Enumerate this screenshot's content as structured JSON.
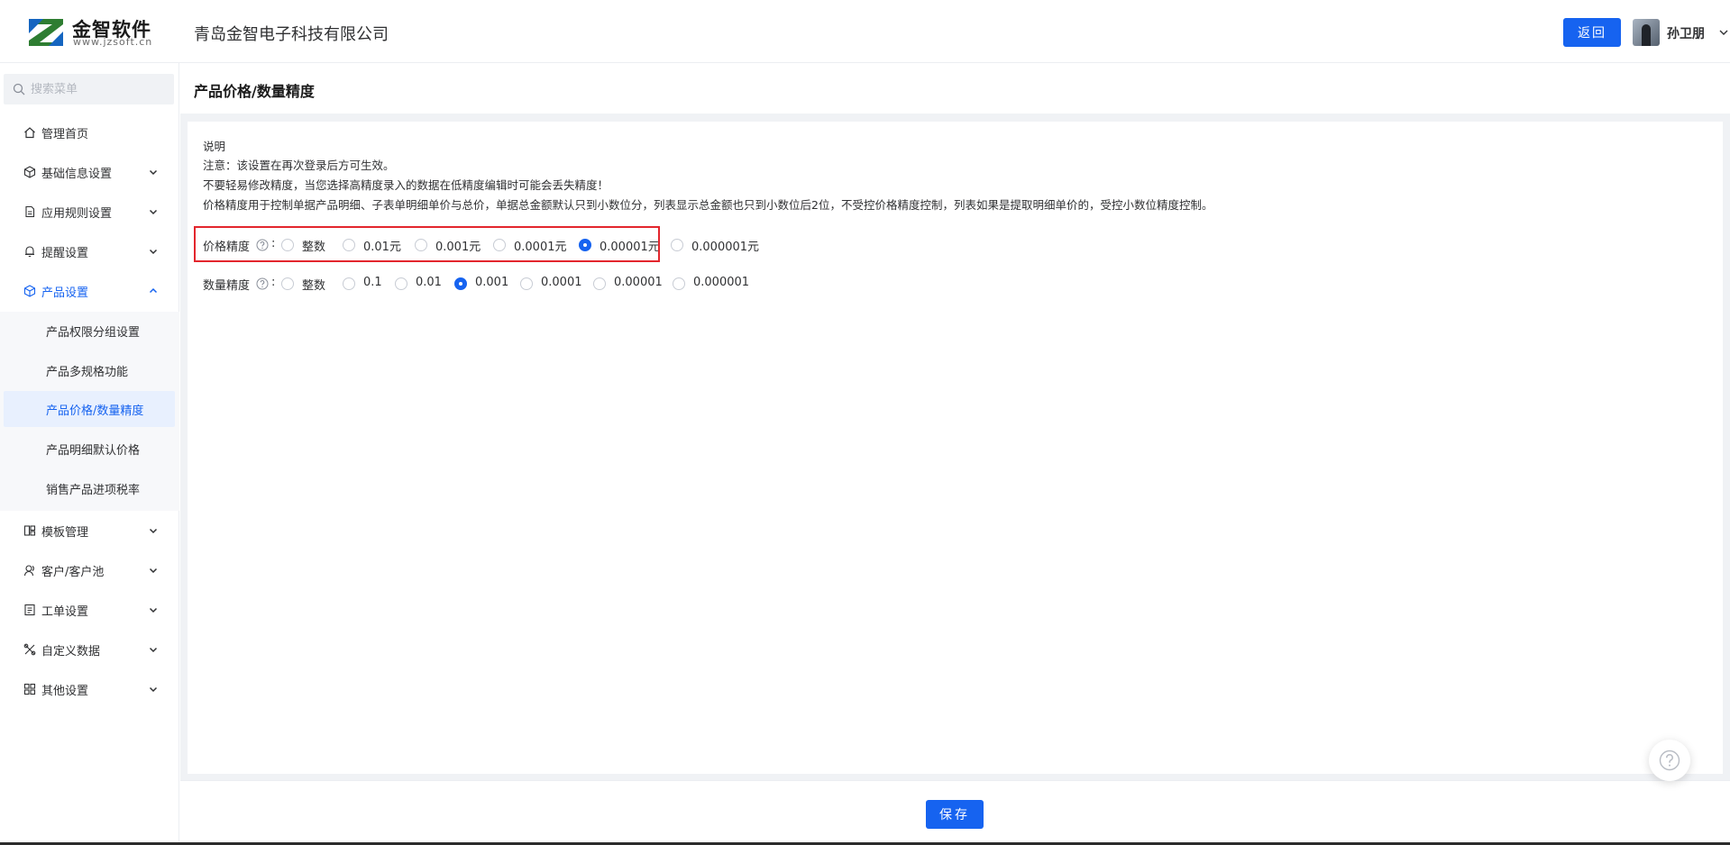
{
  "header": {
    "logo_name": "金智软件",
    "logo_url": "www.jzsoft.cn",
    "company": "青岛金智电子科技有限公司",
    "back_label": "返回",
    "user_name": "孙卫朋"
  },
  "sidebar": {
    "search_placeholder": "搜索菜单",
    "items": [
      {
        "label": "管理首页",
        "icon": "home-icon"
      },
      {
        "label": "基础信息设置",
        "icon": "cube-icon"
      },
      {
        "label": "应用规则设置",
        "icon": "document-icon"
      },
      {
        "label": "提醒设置",
        "icon": "bell-icon"
      },
      {
        "label": "产品设置",
        "icon": "product-icon"
      },
      {
        "label": "模板管理",
        "icon": "template-icon"
      },
      {
        "label": "客户/客户池",
        "icon": "customer-icon"
      },
      {
        "label": "工单设置",
        "icon": "ticket-icon"
      },
      {
        "label": "自定义数据",
        "icon": "tools-icon"
      },
      {
        "label": "其他设置",
        "icon": "grid-icon"
      }
    ],
    "product_sub": [
      {
        "label": "产品权限分组设置"
      },
      {
        "label": "产品多规格功能"
      },
      {
        "label": "产品价格/数量精度"
      },
      {
        "label": "产品明细默认价格"
      },
      {
        "label": "销售产品进项税率"
      }
    ]
  },
  "main": {
    "page_title": "产品价格/数量精度",
    "desc": [
      "说明",
      "注意：该设置在再次登录后方可生效。",
      "不要轻易修改精度，当您选择高精度录入的数据在低精度编辑时可能会丢失精度！",
      "价格精度用于控制单据产品明细、子表单明细单价与总价，单据总金额默认只到小数位分，列表显示总金额也只到小数位后2位，不受控价格精度控制，列表如果是提取明细单价的，受控小数位精度控制。"
    ],
    "price": {
      "label": "价格精度",
      "colon": ":",
      "options": [
        "整数",
        "0.01元",
        "0.001元",
        "0.0001元",
        "0.00001元",
        "0.000001元"
      ],
      "selected": "0.00001元"
    },
    "quantity": {
      "label": "数量精度",
      "colon": ":",
      "options": [
        "整数",
        "0.1",
        "0.01",
        "0.001",
        "0.0001",
        "0.00001",
        "0.000001"
      ],
      "selected": "0.001"
    }
  },
  "footer": {
    "save_label": "保存"
  },
  "colors": {
    "accent": "#1663f0",
    "highlight": "#e3262d"
  }
}
